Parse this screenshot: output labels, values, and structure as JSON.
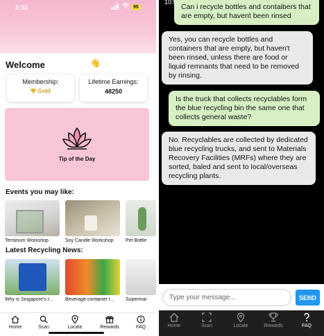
{
  "left": {
    "status": {
      "time": "2:33",
      "battery": "95"
    },
    "welcome": "Welcome",
    "wave_emoji": "👋",
    "membership": {
      "title": "Membership:",
      "tier": "Gold",
      "tier_icon": "gold-gem"
    },
    "earnings": {
      "title": "Lifetime Earnings:",
      "value": "48250"
    },
    "tip": {
      "label": "Tip of the Day",
      "icon": "lotus"
    },
    "events": {
      "title": "Events you may like:",
      "items": [
        {
          "caption": "Terrarium Workshop"
        },
        {
          "caption": "Soy Candle Workshop"
        },
        {
          "caption": "Pet Bottle"
        }
      ]
    },
    "news": {
      "title": "Latest Recycling News:",
      "items": [
        {
          "caption": "Why is Singapore's r..."
        },
        {
          "caption": "Beverage container r..."
        },
        {
          "caption": "Supermar"
        }
      ]
    },
    "tabs": [
      {
        "label": "Home",
        "icon": "home"
      },
      {
        "label": "Scan",
        "icon": "search"
      },
      {
        "label": "Locate",
        "icon": "map-pin"
      },
      {
        "label": "Rewards",
        "icon": "gift"
      },
      {
        "label": "FAQ",
        "icon": "info"
      }
    ],
    "colors": {
      "hero_pink": "#f6b7cf",
      "tip_pink": "#f8c6d6",
      "gold": "#c9a21a"
    }
  },
  "right": {
    "status": {
      "time": "10:5"
    },
    "messages": [
      {
        "role": "user",
        "text": "Can i recycle bottles and contaibers that are empty, but havent been rinsed"
      },
      {
        "role": "bot",
        "text": "Yes, you can recycle bottles and containers that are empty, but haven't been rinsed, unless there are food or liquid remnants that need to be removed by rinsing."
      },
      {
        "role": "user",
        "text": "Is the truck that collects recyclables form the blue recycling bin the same one that collects general waste?"
      },
      {
        "role": "bot",
        "text": "No. Recyclables are collected by dedicated blue recycling trucks, and sent to Materials Recovery Facilities (MRFs) where they are sorted, baled and sent to local/overseas recycling plants."
      }
    ],
    "input": {
      "placeholder": "Type your message...",
      "value": ""
    },
    "send_label": "SEND",
    "tabs": [
      {
        "label": "Home",
        "icon": "home"
      },
      {
        "label": "Scan",
        "icon": "scan-frame"
      },
      {
        "label": "Locate",
        "icon": "map-pin"
      },
      {
        "label": "Rewards",
        "icon": "trophy"
      },
      {
        "label": "FAQ",
        "icon": "question"
      }
    ],
    "colors": {
      "user_bubble": "#d6f0c4",
      "bot_bubble": "#e9e9e9",
      "send": "#2196f3"
    }
  }
}
